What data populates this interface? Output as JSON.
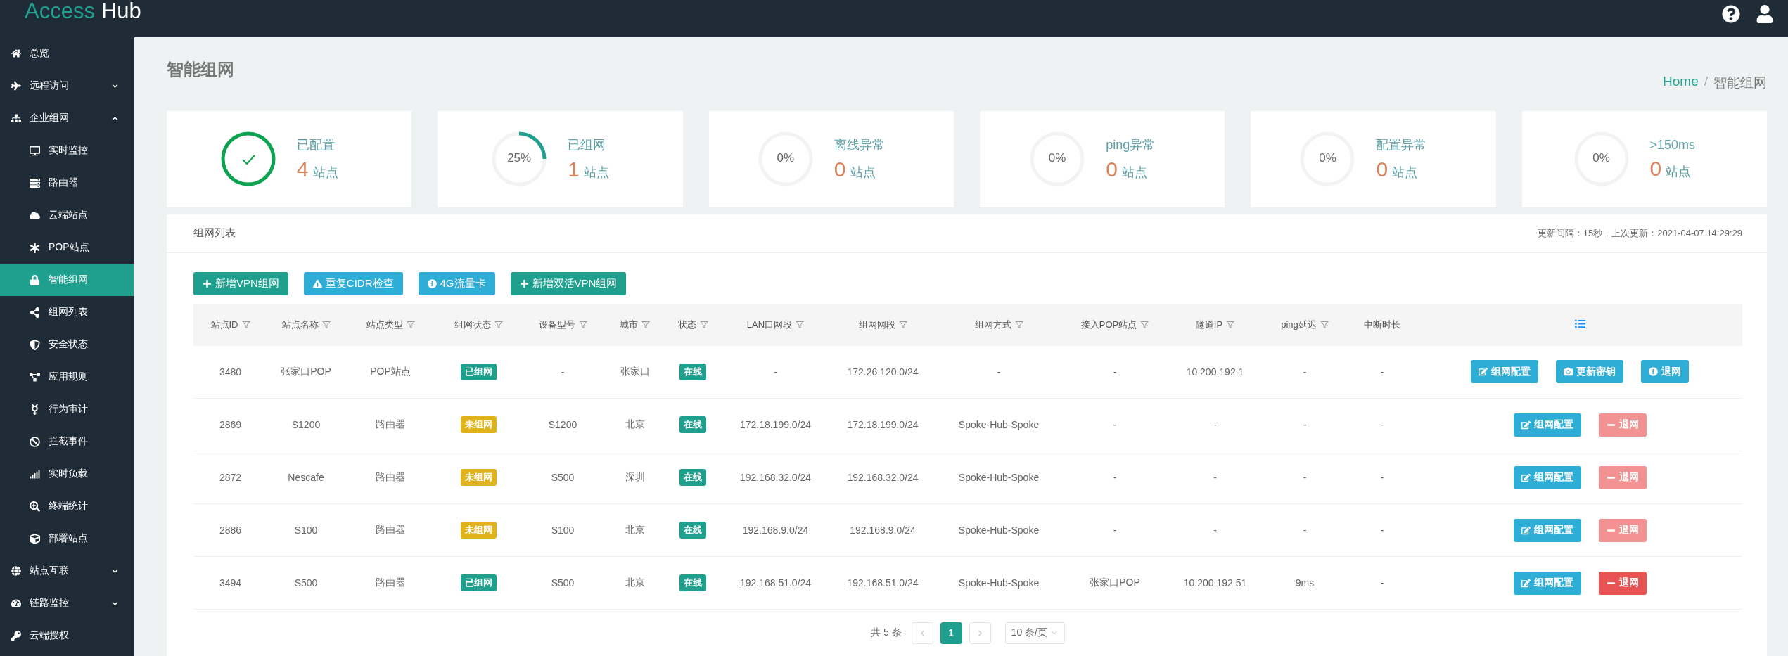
{
  "header": {
    "logo_first": "Access",
    "logo_second": "Hub"
  },
  "sidebar": {
    "items": [
      {
        "label": "总览",
        "selected": false
      },
      {
        "label": "远程访问",
        "selected": false,
        "expanded": false
      },
      {
        "label": "企业组网",
        "selected": false,
        "expanded": true,
        "children": [
          {
            "label": "实时监控",
            "selected": false
          },
          {
            "label": "路由器",
            "selected": false
          },
          {
            "label": "云端站点",
            "selected": false
          },
          {
            "label": "POP站点",
            "selected": false
          },
          {
            "label": "智能组网",
            "selected": true
          },
          {
            "label": "组网列表",
            "selected": false
          },
          {
            "label": "安全状态",
            "selected": false
          },
          {
            "label": "应用规则",
            "selected": false
          },
          {
            "label": "行为审计",
            "selected": false
          },
          {
            "label": "拦截事件",
            "selected": false
          },
          {
            "label": "实时负载",
            "selected": false
          },
          {
            "label": "终端统计",
            "selected": false
          },
          {
            "label": "部署站点",
            "selected": false
          }
        ]
      },
      {
        "label": "站点互联",
        "selected": false,
        "expanded": false
      },
      {
        "label": "链路监控",
        "selected": false,
        "expanded": false
      },
      {
        "label": "云端授权",
        "selected": false
      }
    ]
  },
  "page_title": "智能组网",
  "breadcrumb": {
    "items": [
      "Home",
      "智能组网"
    ],
    "separator": "/"
  },
  "stats": [
    {
      "kind": "check",
      "label": "已配置",
      "value": "4",
      "unit": "站点",
      "level": 1
    },
    {
      "kind": "percent",
      "label": "已组网",
      "value": "1",
      "unit": "站点",
      "percent": "25%",
      "level": 0.25
    },
    {
      "kind": "percent",
      "label": "离线异常",
      "value": "0",
      "unit": "站点",
      "percent": "0%",
      "level": 0
    },
    {
      "kind": "percent",
      "label": "ping异常",
      "value": "0",
      "unit": "站点",
      "percent": "0%",
      "level": 0
    },
    {
      "kind": "percent",
      "label": "配置异常",
      "value": "0",
      "unit": "站点",
      "percent": "0%",
      "level": 0
    },
    {
      "kind": "percent",
      "label": ">150ms",
      "value": "0",
      "unit": "站点",
      "percent": "0%",
      "level": 0
    }
  ],
  "panel": {
    "title": "组网列表",
    "update_info": "更新间隔：15秒，上次更新：2021-04-07 14:29:29"
  },
  "toolbar": [
    {
      "kind": "add",
      "label": "新增VPN组网"
    },
    {
      "kind": "warning",
      "label": "重复CIDR检查"
    },
    {
      "kind": "info",
      "label": "4G流量卡"
    },
    {
      "kind": "add",
      "label": "新增双活VPN组网"
    }
  ],
  "table": {
    "columns": [
      {
        "label": "站点ID",
        "filterable": true
      },
      {
        "label": "站点名称",
        "filterable": true
      },
      {
        "label": "站点类型",
        "filterable": true
      },
      {
        "label": "组网状态",
        "filterable": true
      },
      {
        "label": "设备型号",
        "filterable": true
      },
      {
        "label": "城市",
        "filterable": true
      },
      {
        "label": "状态",
        "filterable": true
      },
      {
        "label": "LAN口网段",
        "filterable": true
      },
      {
        "label": "组网网段",
        "filterable": true
      },
      {
        "label": "组网方式",
        "filterable": true
      },
      {
        "label": "接入POP站点",
        "filterable": true
      },
      {
        "label": "隧道IP",
        "filterable": true
      },
      {
        "label": "ping延迟",
        "filterable": true
      },
      {
        "label": "中断时长",
        "filterable": false
      }
    ],
    "rows": [
      {
        "id": "3480",
        "name": "张家口POP",
        "type": "POP站点",
        "network_status": {
          "label": "已组网",
          "color": "#1fa08e"
        },
        "model": "-",
        "city": "张家口",
        "state": {
          "label": "在线",
          "color": "#1fa08e"
        },
        "lan": "-",
        "subnet": "172.26.120.0/24",
        "mode": "-",
        "pop": "-",
        "tunnel_ip": "10.200.192.1",
        "ping": "-",
        "downtime": "-",
        "actions": [
          {
            "kind": "config",
            "label": "组网配置",
            "disabled": false
          },
          {
            "kind": "rekey",
            "label": "更新密钥",
            "disabled": false
          },
          {
            "kind": "leave",
            "label": "退网",
            "disabled": false
          }
        ]
      },
      {
        "id": "2869",
        "name": "S1200",
        "type": "路由器",
        "network_status": {
          "label": "未组网",
          "color": "#e0b31c"
        },
        "model": "S1200",
        "city": "北京",
        "state": {
          "label": "在线",
          "color": "#1fa08e"
        },
        "lan": "172.18.199.0/24",
        "subnet": "172.18.199.0/24",
        "mode": "Spoke-Hub-Spoke",
        "pop": "-",
        "tunnel_ip": "-",
        "ping": "-",
        "downtime": "-",
        "actions": [
          {
            "kind": "config",
            "label": "组网配置",
            "disabled": false
          },
          {
            "kind": "remove",
            "label": "退网",
            "disabled": true
          }
        ]
      },
      {
        "id": "2872",
        "name": "Nescafe",
        "type": "路由器",
        "network_status": {
          "label": "未组网",
          "color": "#e0b31c"
        },
        "model": "S500",
        "city": "深圳",
        "state": {
          "label": "在线",
          "color": "#1fa08e"
        },
        "lan": "192.168.32.0/24",
        "subnet": "192.168.32.0/24",
        "mode": "Spoke-Hub-Spoke",
        "pop": "-",
        "tunnel_ip": "-",
        "ping": "-",
        "downtime": "-",
        "actions": [
          {
            "kind": "config",
            "label": "组网配置",
            "disabled": false
          },
          {
            "kind": "remove",
            "label": "退网",
            "disabled": true
          }
        ]
      },
      {
        "id": "2886",
        "name": "S100",
        "type": "路由器",
        "network_status": {
          "label": "未组网",
          "color": "#e0b31c"
        },
        "model": "S100",
        "city": "北京",
        "state": {
          "label": "在线",
          "color": "#1fa08e"
        },
        "lan": "192.168.9.0/24",
        "subnet": "192.168.9.0/24",
        "mode": "Spoke-Hub-Spoke",
        "pop": "-",
        "tunnel_ip": "-",
        "ping": "-",
        "downtime": "-",
        "actions": [
          {
            "kind": "config",
            "label": "组网配置",
            "disabled": false
          },
          {
            "kind": "remove",
            "label": "退网",
            "disabled": true
          }
        ]
      },
      {
        "id": "3494",
        "name": "S500",
        "type": "路由器",
        "network_status": {
          "label": "已组网",
          "color": "#1fa08e"
        },
        "model": "S500",
        "city": "北京",
        "state": {
          "label": "在线",
          "color": "#1fa08e"
        },
        "lan": "192.168.51.0/24",
        "subnet": "192.168.51.0/24",
        "mode": "Spoke-Hub-Spoke",
        "pop": "张家口POP",
        "tunnel_ip": "10.200.192.51",
        "ping": "9ms",
        "downtime": "-",
        "actions": [
          {
            "kind": "config",
            "label": "组网配置",
            "disabled": false
          },
          {
            "kind": "remove",
            "label": "退网",
            "disabled": false
          }
        ]
      }
    ]
  },
  "pagination": {
    "total": "共 5 条",
    "pages": [
      {
        "label": "1",
        "selected": true
      }
    ],
    "page_size": "10 条/页"
  }
}
